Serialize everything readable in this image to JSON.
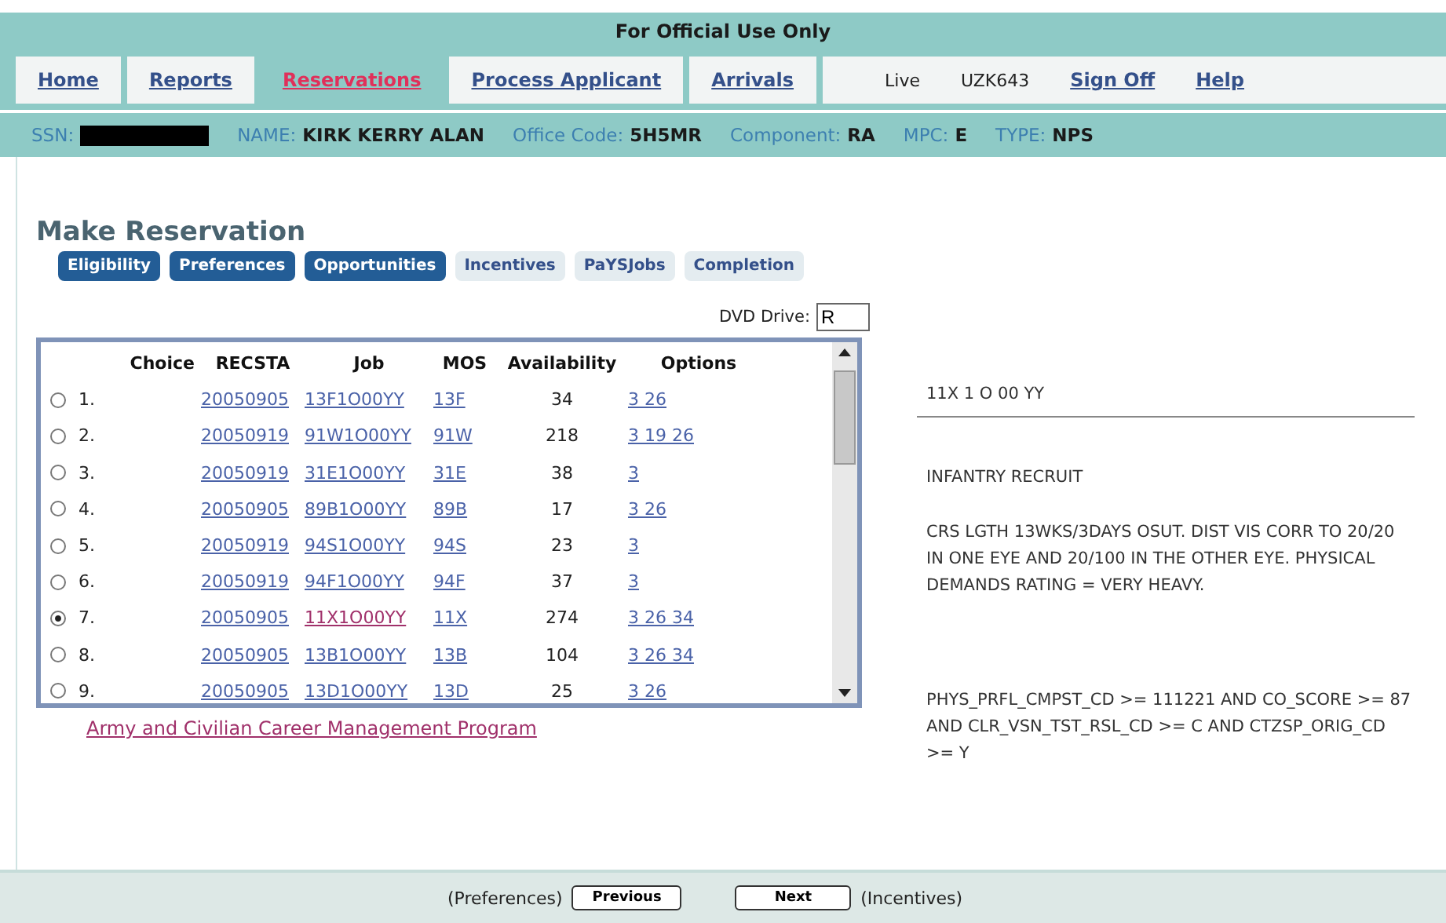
{
  "banner": "For Official Use Only",
  "nav": [
    {
      "label": "Home",
      "selected": false,
      "kind": "link"
    },
    {
      "label": "Reports",
      "selected": false,
      "kind": "link"
    },
    {
      "label": "Reservations",
      "selected": true,
      "kind": "link"
    },
    {
      "label": "Process Applicant",
      "selected": false,
      "kind": "link"
    },
    {
      "label": "Arrivals",
      "selected": false,
      "kind": "link"
    }
  ],
  "session": {
    "mode": "Live",
    "user": "UZK643",
    "sign_off": "Sign Off",
    "help": "Help"
  },
  "ssn": {
    "label": "SSN:",
    "redacted": true
  },
  "applicant": [
    {
      "label": "NAME:",
      "value": "KIRK KERRY ALAN"
    },
    {
      "label": "Office Code:",
      "value": "5H5MR"
    },
    {
      "label": "Component:",
      "value": "RA"
    },
    {
      "label": "MPC:",
      "value": "E"
    },
    {
      "label": "TYPE:",
      "value": "NPS"
    }
  ],
  "heading": "Make Reservation",
  "steps": [
    {
      "label": "Eligibility",
      "done": true
    },
    {
      "label": "Preferences",
      "done": true
    },
    {
      "label": "Opportunities",
      "done": true
    },
    {
      "label": "Incentives",
      "done": false
    },
    {
      "label": "PaYSJobs",
      "done": false
    },
    {
      "label": "Completion",
      "done": false
    }
  ],
  "dvd_drive": {
    "label": "DVD Drive:",
    "value": "R"
  },
  "table": {
    "columns": [
      "Choice",
      "RECSTA",
      "Job",
      "MOS",
      "Availability",
      "Options"
    ],
    "rows": [
      {
        "choice": "1.",
        "selected": false,
        "recsta": "20050905",
        "job": "13F1O00YY",
        "job_visited": false,
        "mos": "13F",
        "availability": "34",
        "options": "3 26"
      },
      {
        "choice": "2.",
        "selected": false,
        "recsta": "20050919",
        "job": "91W1O00YY",
        "job_visited": false,
        "mos": "91W",
        "availability": "218",
        "options": "3 19 26"
      },
      {
        "choice": "3.",
        "selected": false,
        "recsta": "20050919",
        "job": "31E1O00YY",
        "job_visited": false,
        "mos": "31E",
        "availability": "38",
        "options": "3"
      },
      {
        "choice": "4.",
        "selected": false,
        "recsta": "20050905",
        "job": "89B1O00YY",
        "job_visited": false,
        "mos": "89B",
        "availability": "17",
        "options": "3 26"
      },
      {
        "choice": "5.",
        "selected": false,
        "recsta": "20050919",
        "job": "94S1O00YY",
        "job_visited": false,
        "mos": "94S",
        "availability": "23",
        "options": "3"
      },
      {
        "choice": "6.",
        "selected": false,
        "recsta": "20050919",
        "job": "94F1O00YY",
        "job_visited": false,
        "mos": "94F",
        "availability": "37",
        "options": "3"
      },
      {
        "choice": "7.",
        "selected": true,
        "recsta": "20050905",
        "job": "11X1O00YY",
        "job_visited": true,
        "mos": "11X",
        "availability": "274",
        "options": "3 26 34"
      },
      {
        "choice": "8.",
        "selected": false,
        "recsta": "20050905",
        "job": "13B1O00YY",
        "job_visited": false,
        "mos": "13B",
        "availability": "104",
        "options": "3 26 34"
      },
      {
        "choice": "9.",
        "selected": false,
        "recsta": "20050905",
        "job": "13D1O00YY",
        "job_visited": false,
        "mos": "13D",
        "availability": "25",
        "options": "3 26"
      }
    ]
  },
  "program_link": "Army and Civilian Career Management Program",
  "detail": {
    "code": "11X 1 O 00 YY",
    "title": "INFANTRY RECRUIT",
    "description": "CRS LGTH 13WKS/3DAYS OSUT. DIST VIS CORR TO 20/20 IN ONE EYE AND 20/100 IN THE OTHER EYE. PHYSICAL DEMANDS RATING = VERY HEAVY.",
    "requirements": "PHYS_PRFL_CMPST_CD >= 111221 AND CO_SCORE >= 87 AND CLR_VSN_TST_RSL_CD >= C AND CTZSP_ORIG_CD >= Y"
  },
  "footer": {
    "prev_hint": "(Preferences)",
    "previous": "Previous",
    "next": "Next",
    "next_hint": "(Incentives)"
  }
}
